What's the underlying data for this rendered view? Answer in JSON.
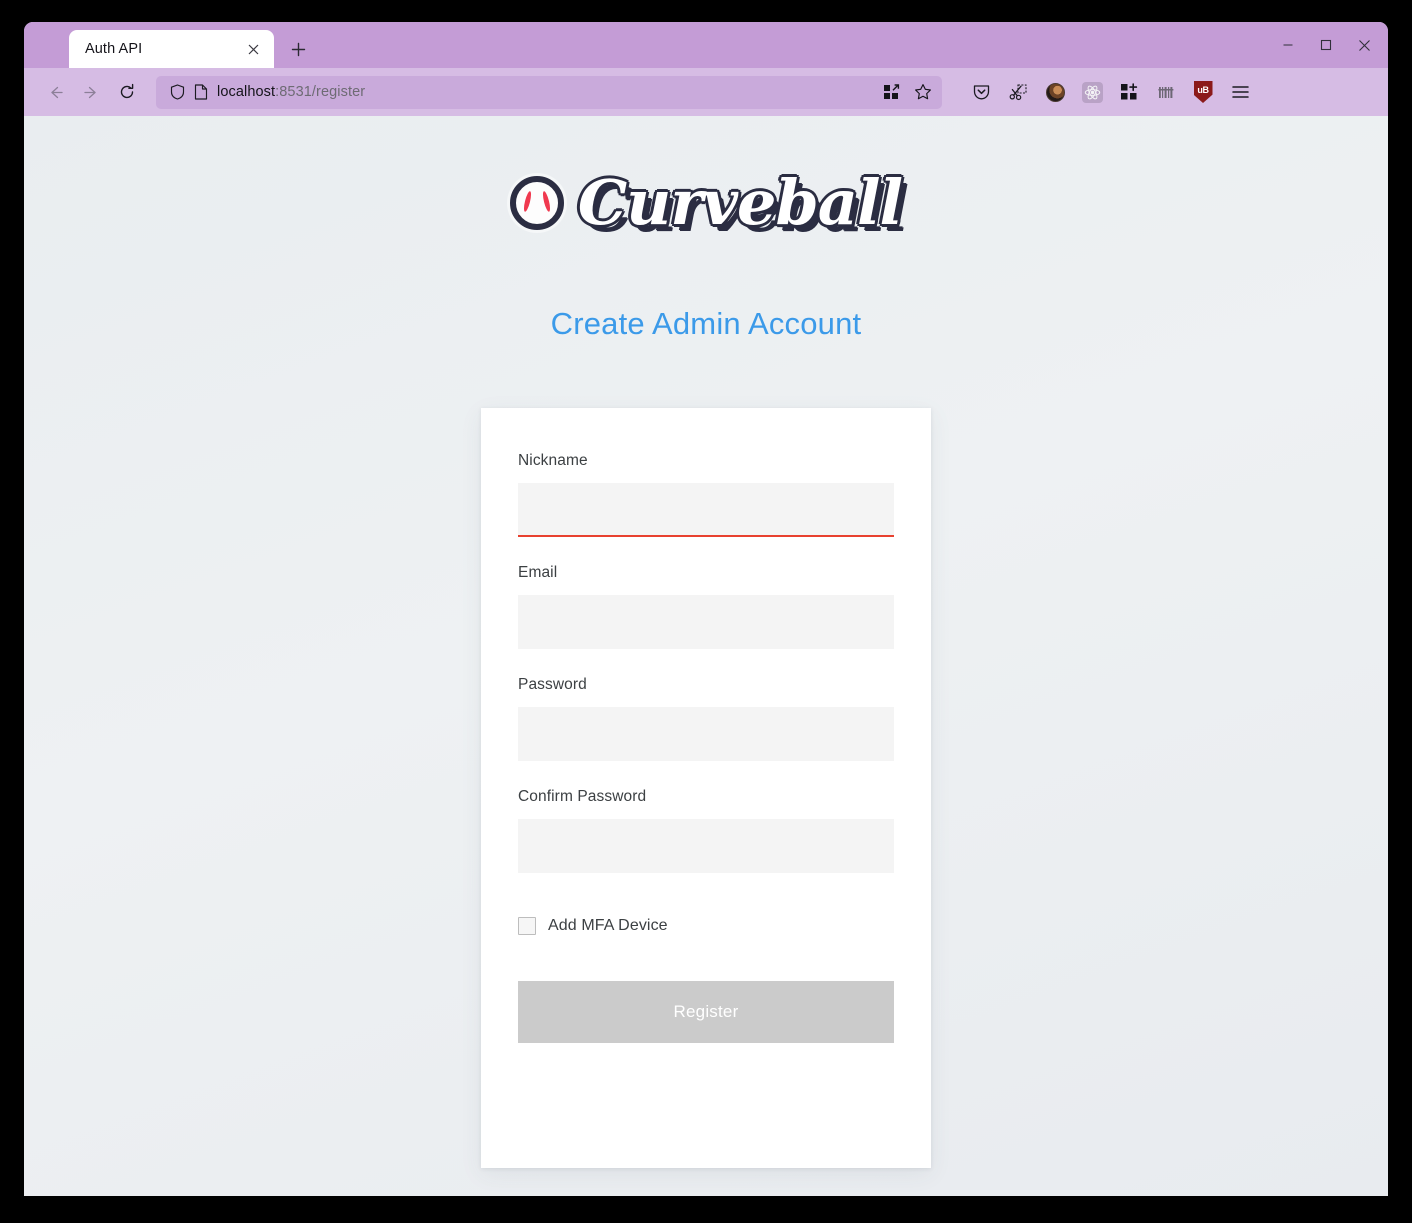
{
  "browser": {
    "tab": {
      "title": "Auth API",
      "close_icon": "close-icon"
    },
    "new_tab_label": "+",
    "window_controls": {
      "minimize": "minimize-icon",
      "maximize": "maximize-icon",
      "close": "close-icon"
    },
    "nav": {
      "back": "back-arrow-icon",
      "forward": "forward-arrow-icon",
      "reload": "reload-icon"
    },
    "url": {
      "host": "localhost",
      "path": ":8531/register",
      "shield_icon": "tracking-protection-shield-icon",
      "page_icon": "page-document-icon",
      "extensions_icon": "extensions-grid-icon",
      "bookmark_icon": "bookmark-star-icon"
    },
    "extensions": [
      {
        "name": "pocket-icon",
        "label": "Pocket"
      },
      {
        "name": "screenshot-scissors-icon",
        "label": "Screenshot"
      },
      {
        "name": "account-avatar-icon",
        "label": "Account"
      },
      {
        "name": "react-devtools-icon",
        "label": "React Developer Tools"
      },
      {
        "name": "add-extension-icon",
        "label": "Extensions"
      },
      {
        "name": "barcode-icon",
        "label": "Barcode"
      },
      {
        "name": "ublock-origin-icon",
        "label": "uB"
      },
      {
        "name": "app-menu-hamburger-icon",
        "label": "Open application menu"
      }
    ]
  },
  "page": {
    "logo": {
      "wordmark": "Curveball",
      "ball_icon": "baseball-icon"
    },
    "title": "Create Admin Account",
    "form": {
      "fields": [
        {
          "label": "Nickname",
          "value": "",
          "placeholder": "",
          "error": true
        },
        {
          "label": "Email",
          "value": "",
          "placeholder": "",
          "error": false
        },
        {
          "label": "Password",
          "value": "",
          "placeholder": "",
          "error": false
        },
        {
          "label": "Confirm Password",
          "value": "",
          "placeholder": "",
          "error": false
        }
      ],
      "mfa_checkbox": {
        "label": "Add MFA Device",
        "checked": false
      },
      "submit_label": "Register"
    }
  },
  "colors": {
    "accent_blue": "#3b9ae9",
    "error_red": "#e8412f",
    "logo_navy": "#2b2d42",
    "logo_red": "#f0394f",
    "page_bg": "#eceff1",
    "chrome_purple": "#c49cd6",
    "disabled_gray": "#cbcbcb"
  }
}
